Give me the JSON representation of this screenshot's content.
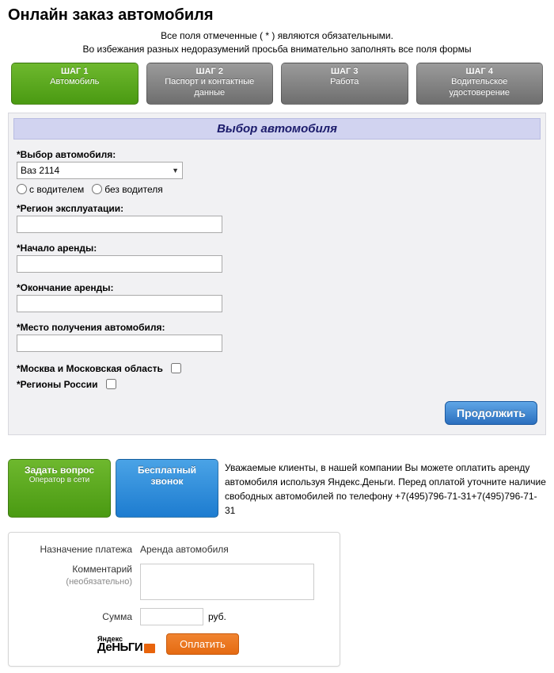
{
  "title": "Онлайн заказ автомобиля",
  "notes": {
    "required": "Все поля отмеченные ( * ) являются обязательными.",
    "warning": "Во избежания разных недоразумений просьба внимательно заполнять все поля формы"
  },
  "steps": [
    {
      "top": "ШАГ 1",
      "bottom": "Автомобиль"
    },
    {
      "top": "ШАГ 2",
      "bottom": "Паспорт и контактные данные"
    },
    {
      "top": "ШАГ 3",
      "bottom": "Работа"
    },
    {
      "top": "ШАГ 4",
      "bottom": "Водительское удостоверение"
    }
  ],
  "section_header": "Выбор автомобиля",
  "fields": {
    "car_select_label": "*Выбор автомобиля:",
    "car_select_value": "Ваз 2114",
    "radio_with_driver": "с водителем",
    "radio_without_driver": "без водителя",
    "region_label": "*Регион эксплуатации:",
    "start_label": "*Начало аренды:",
    "end_label": "*Окончание аренды:",
    "pickup_label": "*Место получения автомобиля:",
    "moscow_label": "*Москва и Московская область",
    "regions_label": "*Регионы России"
  },
  "continue_label": "Продолжить",
  "action_buttons": {
    "ask": {
      "line1": "Задать вопрос",
      "sub": "Оператор в сети"
    },
    "call": {
      "line1": "Бесплатный",
      "line2": "звонок"
    }
  },
  "info_text": "Уважаемые клиенты, в нашей компании Вы можете оплатить аренду автомобиля используя Яндекс.Деньги. Перед оплатой уточните наличие свободных автомобилей по телефону +7(495)796-71-31+7(495)796-71-31",
  "payment": {
    "purpose_label": "Назначение платежа",
    "purpose_value": "Аренда автомобиля",
    "comment_label": "Комментарий",
    "comment_hint": "(необязательно)",
    "sum_label": "Сумма",
    "currency": "руб.",
    "logo_top": "Яндекс",
    "logo_bottom": "ДеНЬГИ",
    "pay_button": "Оплатить"
  }
}
